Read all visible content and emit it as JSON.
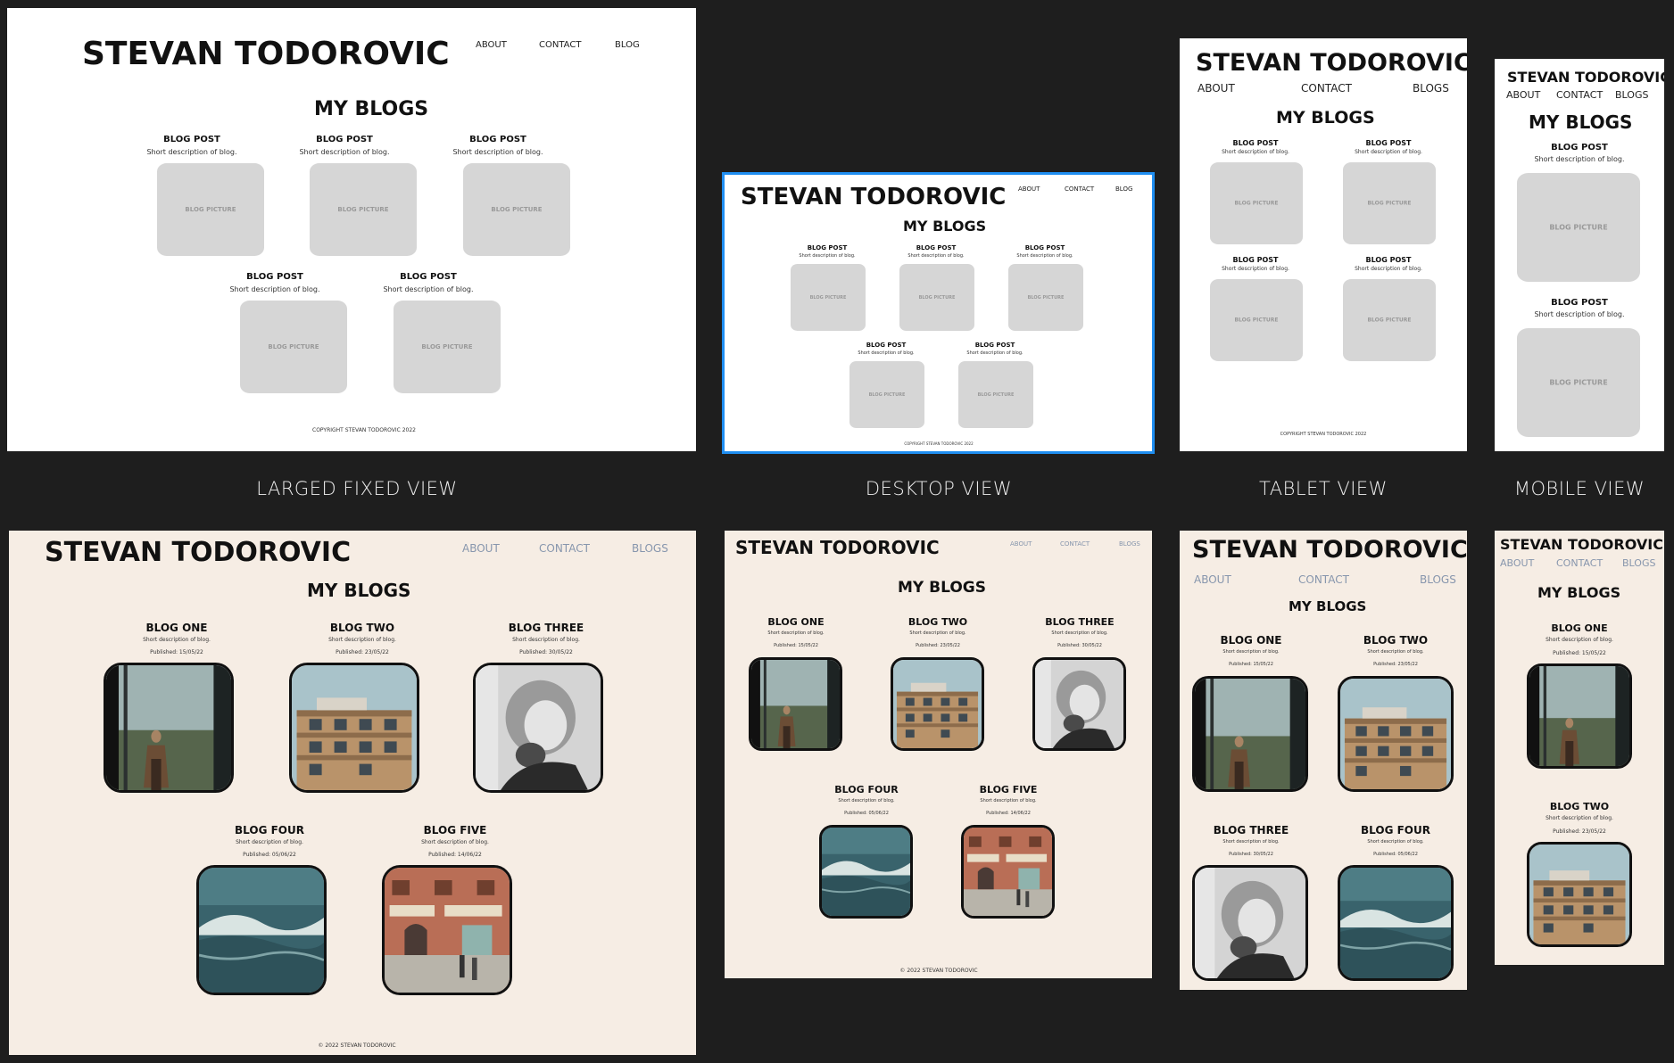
{
  "captions": {
    "large": "LARGED FIXED VIEW",
    "desktop": "DESKTOP VIEW",
    "tablet": "TABLET VIEW",
    "mobile": "MOBILE VIEW"
  },
  "wireframe": {
    "site_title": "STEVAN TODOROVIC",
    "nav_about": "ABOUT",
    "nav_contact": "CONTACT",
    "nav_blog": "BLOG",
    "nav_blogs": "BLOGS",
    "heading": "MY BLOGS",
    "post_title": "BLOG POST",
    "post_desc": "Short description of blog.",
    "placeholder": "BLOG PICTURE",
    "footer": "COPYRIGHT STEVAN TODOROVIC 2022"
  },
  "styled": {
    "site_title": "STEVAN TODOROVIC",
    "nav_about": "ABOUT",
    "nav_contact": "CONTACT",
    "nav_blogs": "BLOGS",
    "heading": "MY BLOGS",
    "desc": "Short description of blog.",
    "footer": "© 2022 STEVAN TODOROVIC",
    "posts": [
      {
        "title": "BLOG ONE",
        "published": "Published: 15/05/22",
        "image": "window-woman-photo"
      },
      {
        "title": "BLOG TWO",
        "published": "Published: 23/05/22",
        "image": "apartment-building-photo"
      },
      {
        "title": "BLOG THREE",
        "published": "Published: 30/05/22",
        "image": "helmet-portrait-photo"
      },
      {
        "title": "BLOG FOUR",
        "published": "Published: 05/06/22",
        "image": "ocean-wave-photo"
      },
      {
        "title": "BLOG FIVE",
        "published": "Published: 14/06/22",
        "image": "street-storefront-photo"
      }
    ]
  },
  "colors": {
    "background": "#1e1e1e",
    "styled_background": "#f6ede4",
    "nav_muted": "#8796ad",
    "placeholder": "#d6d6d6",
    "selection": "#1f8ef1"
  }
}
